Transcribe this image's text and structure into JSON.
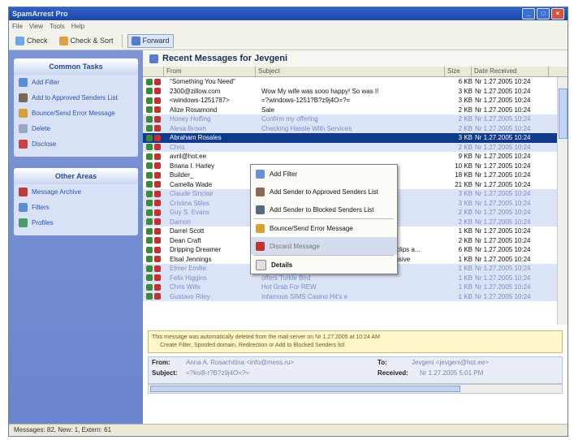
{
  "window": {
    "title": "SpamArrest Pro"
  },
  "menu": [
    "File",
    "View",
    "Tools",
    "Help"
  ],
  "toolbar": {
    "check": "Check",
    "check_all": "Check & Sort",
    "forward": "Forward"
  },
  "sidebar": {
    "common_tasks": {
      "title": "Common Tasks",
      "items": [
        "Add Filter",
        "Add to Approved Senders List",
        "Bounce/Send Error Message",
        "Delete",
        "Disclose"
      ]
    },
    "other_areas": {
      "title": "Other Areas",
      "items": [
        "Message Archive",
        "Filters",
        "Profiles"
      ]
    }
  },
  "messages": {
    "title": "Recent Messages for Jevgeni",
    "columns": {
      "from": "From",
      "subject": "Subject",
      "size": "Size",
      "date": "Date Received"
    },
    "rows": [
      {
        "from": "\"Something You Need\"",
        "subject": "",
        "size": "6 KB",
        "date": "Nr 1.27.2005 10:24",
        "style": ""
      },
      {
        "from": "2300@zillow.com",
        "subject": "Wow My wife was sooo happy! So was I!",
        "size": "3 KB",
        "date": "Nr 1.27.2005 10:24",
        "style": ""
      },
      {
        "from": "<windows-1251787>",
        "subject": "=?windows-1251?B?z9j4O=?=",
        "size": "3 KB",
        "date": "Nr 1.27.2005 10:24",
        "style": ""
      },
      {
        "from": "Alize Rosamond",
        "subject": "Sale",
        "size": "2 KB",
        "date": "Nr 1.27.2005 10:24",
        "style": ""
      },
      {
        "from": "Honey Hoffing",
        "subject": "Confirm my offering",
        "size": "2 KB",
        "date": "Nr 1.27.2005 10:24",
        "style": "hl"
      },
      {
        "from": "Alexa Brown",
        "subject": "Checking Hassle With Services",
        "size": "2 KB",
        "date": "Nr 1.27.2005 10:24",
        "style": "hl"
      },
      {
        "from": "Abraham Rosales",
        "subject": "",
        "size": "3 KB",
        "date": "Nr 1.27.2005 10:24",
        "style": "sel"
      },
      {
        "from": "Chris",
        "subject": "",
        "size": "2 KB",
        "date": "Nr 1.27.2005 10:24",
        "style": "hl"
      },
      {
        "from": "avril@hot.ee",
        "subject": "",
        "size": "9 KB",
        "date": "Nr 1.27.2005 10:24",
        "style": ""
      },
      {
        "from": "Briana I. Harley",
        "subject": "",
        "size": "10 KB",
        "date": "Nr 1.27.2005 10:24",
        "style": ""
      },
      {
        "from": "Builder_",
        "subject": "",
        "size": "18 KB",
        "date": "Nr 1.27.2005 10:24",
        "style": ""
      },
      {
        "from": "Camella Wade",
        "subject": "",
        "size": "21 KB",
        "date": "Nr 1.27.2005 10:24",
        "style": ""
      },
      {
        "from": "Claude Sinclair",
        "subject": "",
        "size": "3 KB",
        "date": "Nr 1.27.2005 10:24",
        "style": "hl"
      },
      {
        "from": "Cristina Stiles",
        "subject": "",
        "size": "3 KB",
        "date": "Nr 1.27.2005 10:24",
        "style": "hl"
      },
      {
        "from": "Guy S. Evans",
        "subject": "",
        "size": "2 KB",
        "date": "Nr 1.27.2005 10:24",
        "style": "hl"
      },
      {
        "from": "Damon",
        "subject": "",
        "size": "2 KB",
        "date": "Nr 1.27.2005 10:24",
        "style": "hl"
      },
      {
        "from": "Darrel Scott",
        "subject": "",
        "size": "1 KB",
        "date": "Nr 1.27.2005 10:24",
        "style": ""
      },
      {
        "from": "Dean Craft",
        "subject": "Brand New Legal software at AffOrdable Prices",
        "size": "2 KB",
        "date": "Nr 1.27.2005 10:24",
        "style": ""
      },
      {
        "from": "Dripping Dreamer",
        "subject": "SEXUALLY-EXPLICIT: Extreme Dripping Videoclips a...",
        "size": "6 KB",
        "date": "Nr 1.27.2005 10:24",
        "style": ""
      },
      {
        "from": "Elsal Jennings",
        "subject": "PACKET CARTER : Expensive Look Not Expensive",
        "size": "1 KB",
        "date": "Nr 1.27.2005 10:24",
        "style": ""
      },
      {
        "from": "Elmer Emilie",
        "subject": "Fall your Commission 57 2005",
        "size": "1 KB",
        "date": "Nr 1.27.2005 10:24",
        "style": "hl"
      },
      {
        "from": "Felix Higgins",
        "subject": "offers Turkle Bird",
        "size": "1 KB",
        "date": "Nr 1.27.2005 10:24",
        "style": "hl"
      },
      {
        "from": "Chris Wills",
        "subject": "Hot Grab For REW",
        "size": "1 KB",
        "date": "Nr 1.27.2005 10:24",
        "style": "hl"
      },
      {
        "from": "Gustavo Riley",
        "subject": "Infamous SIMS Casino Hit's e",
        "size": "1 KB",
        "date": "Nr 1.27.2005 10:24",
        "style": "hl"
      }
    ]
  },
  "context_menu": {
    "items": [
      {
        "label": "Add Filter",
        "icon": "filter-icon"
      },
      {
        "label": "Add Sender to Approved Senders List",
        "icon": "approved-sender-icon"
      },
      {
        "label": "Add Sender to Blocked Senders List",
        "icon": "blocked-sender-icon"
      },
      {
        "label": "Bounce/Send Error Message",
        "icon": "bounce-icon"
      },
      {
        "label": "Discard Message",
        "icon": "discard-icon"
      },
      {
        "label": "Details",
        "icon": "details-icon"
      }
    ]
  },
  "notice": {
    "line1": "This message was automatically deleted from the mail server on Nr 1.27.2005 at 10:24 AM",
    "line2": "Create Filter, Spoofed domain, Redirection or Add to Blocked Senders list"
  },
  "headers": {
    "from_label": "From:",
    "from_value": "Anna A. Rosachitina <info@mess.ru>",
    "to_label": "To:",
    "to_value": "Jevgeni <jevgeni@hot.ee>",
    "subject_label": "Subject:",
    "subject_value": "=?koi8-r?B?z9j4O=?=",
    "received_label": "Received:",
    "received_value": "Nr 1.27.2005 5:01 PM"
  },
  "status": "Messages: 82, New: 1, Extern: 61"
}
